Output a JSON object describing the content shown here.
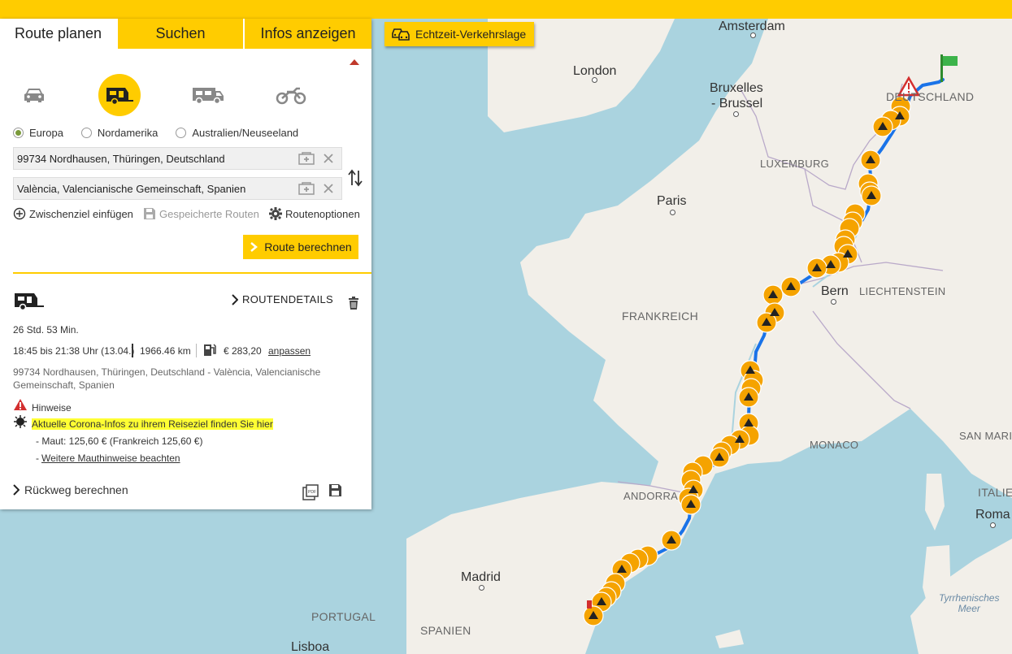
{
  "tabs": [
    {
      "label": "Route planen"
    },
    {
      "label": "Suchen"
    },
    {
      "label": "Infos anzeigen"
    }
  ],
  "traffic_button": {
    "label": "Echtzeit-Verkehrslage"
  },
  "vehicles": [
    "car-icon",
    "caravan-icon",
    "motorhome-icon",
    "motorcycle-icon"
  ],
  "regions": [
    {
      "label": "Europa",
      "selected": true
    },
    {
      "label": "Nordamerika",
      "selected": false
    },
    {
      "label": "Australien/Neuseeland",
      "selected": false
    }
  ],
  "start_field": {
    "value": "99734 Nordhausen, Thüringen, Deutschland"
  },
  "dest_field": {
    "value": "València, Valencianische Gemeinschaft, Spanien"
  },
  "actions": {
    "add_waypoint": "Zwischenziel einfügen",
    "saved_routes": "Gespeicherte Routen",
    "route_options": "Routenoptionen"
  },
  "calc_button": {
    "label": "Route berechnen"
  },
  "result": {
    "routedetails_label": "ROUTENDETAILS",
    "duration": "26 Std. 53 Min.",
    "time_range": "18:45 bis 21:38 Uhr (13.04.)",
    "distance": "1966.46 km",
    "fuel_cost": "€ 283,20",
    "adjust_link": "anpassen",
    "route_desc": "99734 Nordhausen, Thüringen, Deutschland - València, Valencianische Gemeinschaft, Spanien",
    "hints_label": "Hinweise",
    "corona_link": "Aktuelle Corona-Infos zu ihrem Reiseziel finden Sie hier",
    "toll_text": "- Maut: 125,60 € (Frankreich 125,60 €)",
    "toll_dash": "-",
    "toll_link": "Weitere Mauthinweise beachten",
    "return_label": "Rückweg berechnen"
  },
  "map": {
    "cities": [
      "Amsterdam",
      "London",
      "Bruxelles",
      "- Brussel",
      "Paris",
      "Bern",
      "Madrid",
      "Lisboa",
      "Roma"
    ],
    "countries": [
      "DEUTSCHLAND",
      "LUXEMBURG",
      "LIECHTENSTEIN",
      "FRANKREICH",
      "MONACO",
      "SAN MARI",
      "ANDORRA",
      "ITALIE",
      "PORTUGAL",
      "SPANIEN"
    ],
    "seas": [
      "Tyrrhenisches",
      "Meer"
    ]
  },
  "colors": {
    "brand_yellow": "#ffcc00",
    "route_blue": "#1a73e8",
    "camp_orange": "#f5a300",
    "warning_red": "#d32f2f"
  }
}
